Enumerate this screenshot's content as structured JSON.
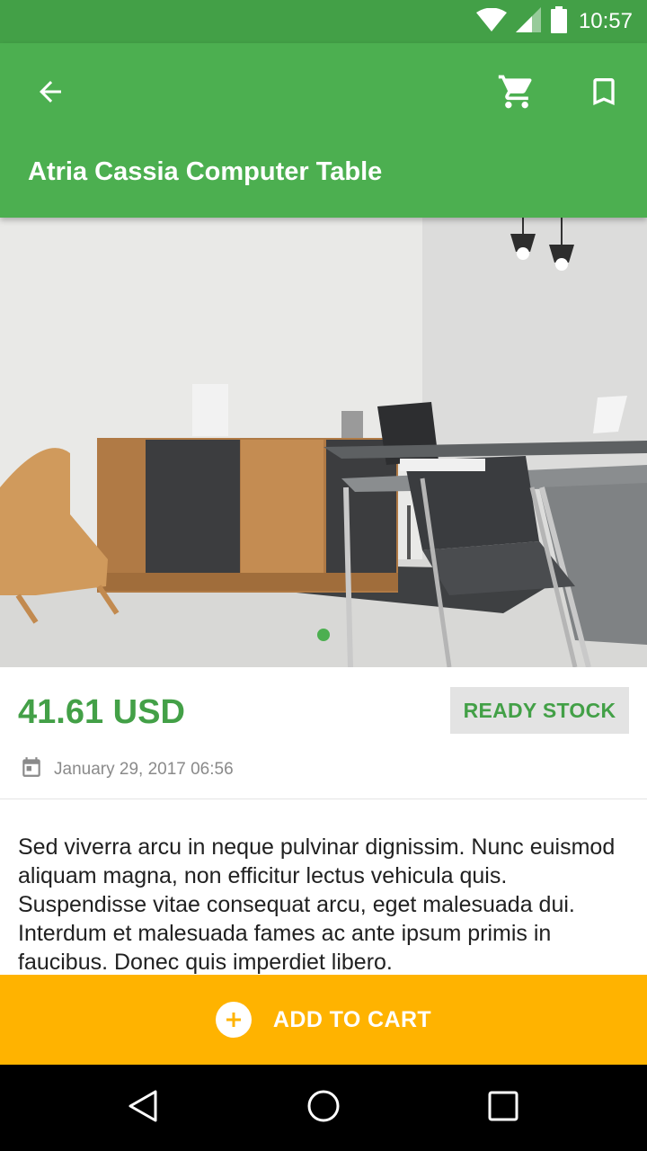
{
  "status_bar": {
    "time": "10:57",
    "icons": [
      "wifi-icon",
      "signal-icon",
      "battery-icon"
    ]
  },
  "app_bar": {
    "title": "Atria Cassia Computer Table",
    "icons": [
      "back-arrow-icon",
      "cart-icon",
      "bookmark-icon"
    ],
    "color": "#4caf50"
  },
  "product": {
    "price": "41.61 USD",
    "stock_status": "READY STOCK",
    "date": "January 29, 2017 06:56",
    "description": "Sed viverra arcu in neque pulvinar dignissim. Nunc euismod aliquam magna, non efficitur lectus vehicula quis. Suspendisse vitae consequat arcu, eget malesuada dui. Interdum et malesuada fames ac ante ipsum primis in faucibus. Donec quis imperdiet libero."
  },
  "image_slider": {
    "total_pages": 1,
    "active_page": 1
  },
  "cta": {
    "label": "ADD TO CART",
    "icon": "plus-circle-icon",
    "color": "#ffb300"
  },
  "nav_bar": {
    "icons": [
      "nav-back-icon",
      "nav-home-icon",
      "nav-recents-icon"
    ]
  }
}
